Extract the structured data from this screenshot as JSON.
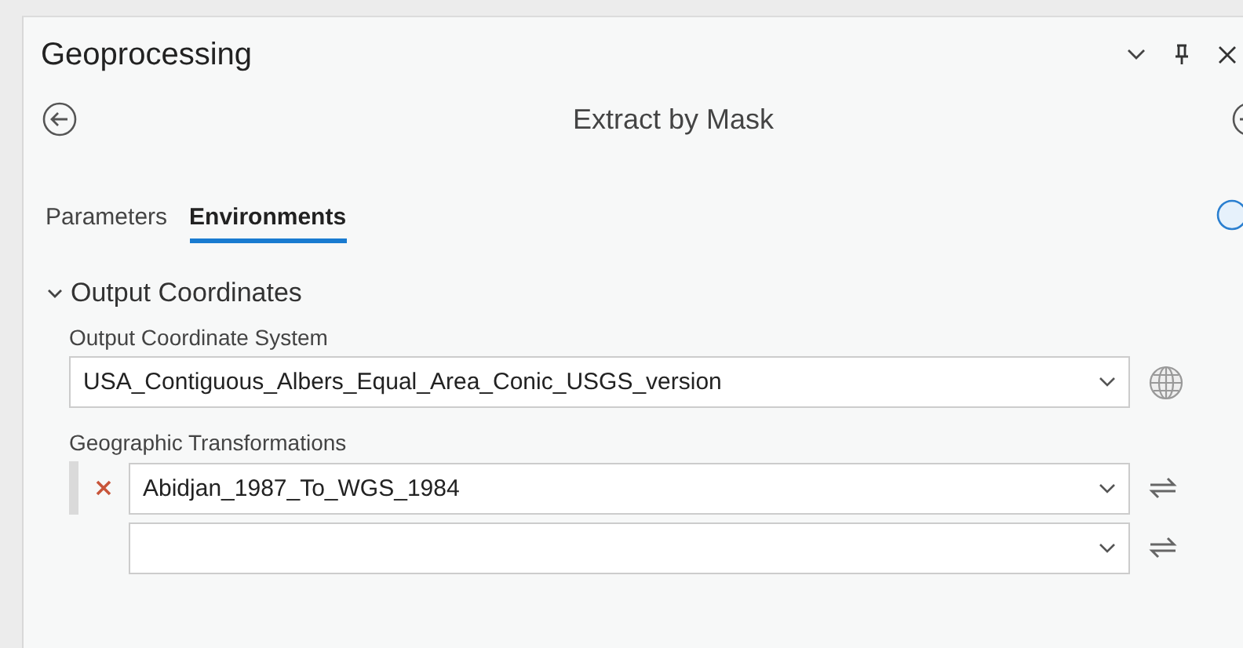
{
  "pane": {
    "title": "Geoprocessing"
  },
  "tool": {
    "title": "Extract by Mask"
  },
  "tabs": [
    {
      "label": "Parameters",
      "selected": false
    },
    {
      "label": "Environments",
      "selected": true
    }
  ],
  "section": {
    "title": "Output Coordinates",
    "expanded": true
  },
  "output_coordinate_system": {
    "label": "Output Coordinate System",
    "value": "USA_Contiguous_Albers_Equal_Area_Conic_USGS_version"
  },
  "geographic_transformations": {
    "label": "Geographic Transformations",
    "rows": [
      {
        "kind": "filled",
        "value": "Abidjan_1987_To_WGS_1984"
      },
      {
        "kind": "empty"
      }
    ]
  }
}
